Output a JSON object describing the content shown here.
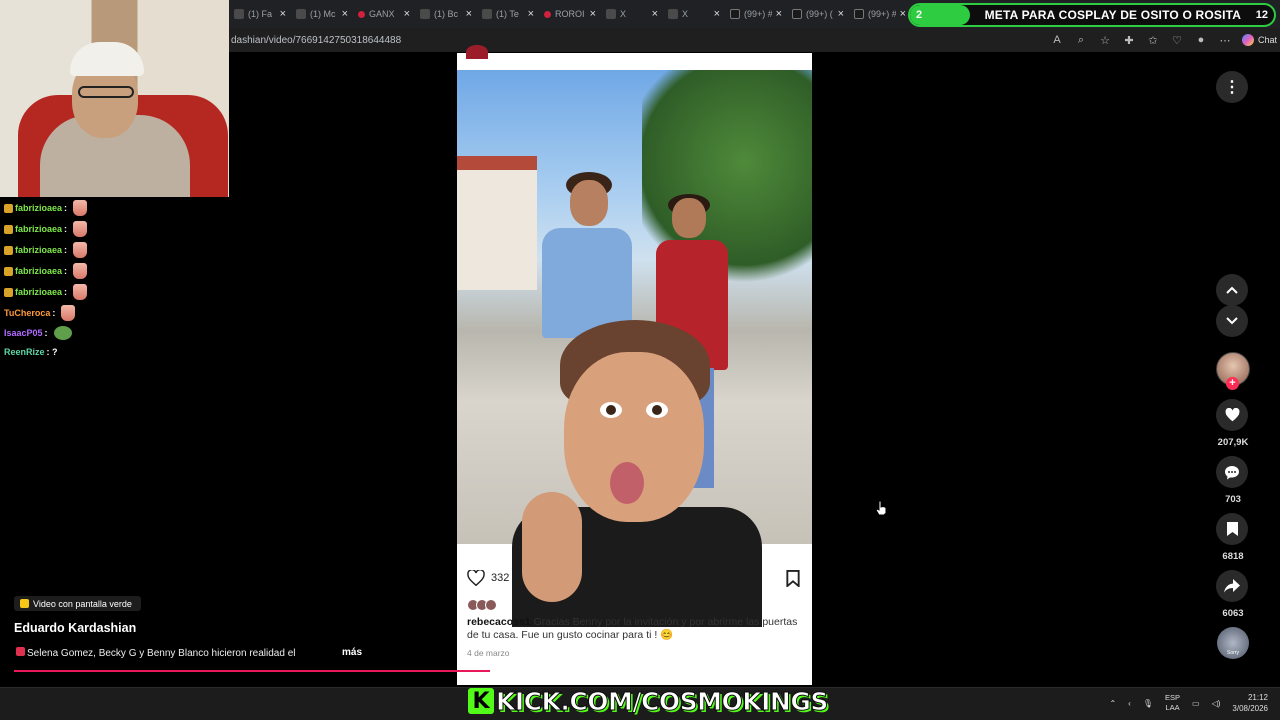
{
  "browser": {
    "tabs": [
      {
        "label": "(1) Fa",
        "icon": "x"
      },
      {
        "label": "(1) Mc",
        "icon": "x"
      },
      {
        "label": "GANX",
        "icon": "red"
      },
      {
        "label": "(1) Bc",
        "icon": "x"
      },
      {
        "label": "(1) Te",
        "icon": "x"
      },
      {
        "label": "ROROI",
        "icon": "red"
      },
      {
        "label": "X",
        "icon": "x"
      },
      {
        "label": "X",
        "icon": "x"
      },
      {
        "label": "(99+) #",
        "icon": "tt"
      },
      {
        "label": "(99+) (",
        "icon": "tt"
      },
      {
        "label": "(99+) #",
        "icon": "tt"
      },
      {
        "label": "",
        "icon": "tt"
      }
    ],
    "url": "dashian/video/7669142750318644488",
    "chat_button": "Chat"
  },
  "stream_goal": {
    "count": "2",
    "title": "META PARA COSPLAY DE OSITO O ROSITA",
    "target": "12"
  },
  "chat_messages": [
    {
      "user": "fabrizioaea",
      "color": "#7ee84a",
      "suffix": ":",
      "badge": true,
      "emote": "patrick"
    },
    {
      "user": "fabrizioaea",
      "color": "#7ee84a",
      "suffix": ":",
      "badge": true,
      "emote": "patrick"
    },
    {
      "user": "fabrizioaea",
      "color": "#7ee84a",
      "suffix": ":",
      "badge": true,
      "emote": "patrick"
    },
    {
      "user": "fabrizioaea",
      "color": "#7ee84a",
      "suffix": ":",
      "badge": true,
      "emote": "patrick"
    },
    {
      "user": "fabrizioaea",
      "color": "#7ee84a",
      "suffix": ":",
      "badge": true,
      "emote": "patrick"
    },
    {
      "user": "TuCheroca",
      "color": "#ff9a3a",
      "suffix": ":",
      "badge": false,
      "emote": "patrick"
    },
    {
      "user": "IsaacP05",
      "color": "#b26bff",
      "suffix": ":",
      "badge": false,
      "emote": "pepe"
    },
    {
      "user": "ReenRize",
      "color": "#5fd6a8",
      "suffix": ": ?",
      "badge": false,
      "emote": ""
    }
  ],
  "video_info": {
    "green_screen_label": "Video con pantalla verde",
    "author": "Eduardo Kardashian",
    "description": "Selena Gomez, Becky G y Benny Blanco hicieron realidad el",
    "more": "más",
    "progress": 0.38
  },
  "post": {
    "likes": "332",
    "caption_user": "rebecacoss1",
    "caption_text": "Gracias Benny por la invitación y por abrirme las puertas de tu casa. Fue un gusto cocinar para ti ! 😊",
    "date": "4 de marzo"
  },
  "rail": {
    "likes": "207,9K",
    "comments": "703",
    "saves": "6818",
    "shares": "6063",
    "music_label": "Sorry"
  },
  "overlay": {
    "kick_letter": "K",
    "kick_text": "KICK.COM/COSMOKINGS"
  },
  "taskbar": {
    "lang_top": "ESP",
    "lang_bottom": "LAA",
    "time": "21:12",
    "date": "3/08/2026"
  },
  "colors": {
    "kick_green": "#53fc18",
    "tiktok_red": "#fe2c55",
    "goal_green": "#2ecc40"
  }
}
